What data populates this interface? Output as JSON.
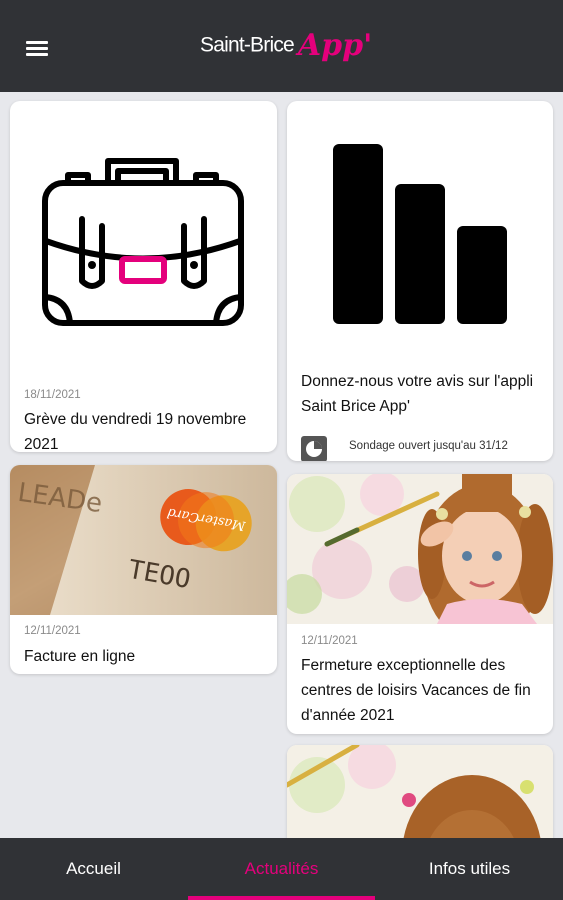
{
  "app": {
    "brand_name": "Saint-Brice",
    "brand_app": "App'",
    "accent_color": "#e4007c",
    "header_color": "#303236"
  },
  "header": {
    "menu_icon": "hamburger-menu-icon"
  },
  "cards": [
    {
      "date": "18/11/2021",
      "title": "Grève du vendredi 19 novembre 2021",
      "media_icon": "briefcase-icon"
    },
    {
      "date": "12/11/2021",
      "title": "Facture en ligne",
      "media_icon": "credit-card-image"
    },
    {
      "title": "Donnez-nous votre avis sur l'appli Saint Brice App'",
      "media_icon": "bar-chart-icon",
      "poll_status": "Sondage ouvert jusqu'au 31/12",
      "poll_icon": "pie-chart-icon"
    },
    {
      "date": "12/11/2021",
      "title": "Fermeture exceptionnelle des centres de loisirs Vacances de fin d'année 2021",
      "media_icon": "child-painting-image"
    },
    {
      "media_icon": "child-painting-image"
    }
  ],
  "card_text": {
    "mastercard_word": "MasterCard",
    "card_number_fragment": "TEOO"
  },
  "tabs": [
    {
      "label": "Accueil",
      "active": false
    },
    {
      "label": "Actualités",
      "active": true
    },
    {
      "label": "Infos utiles",
      "active": false
    }
  ]
}
